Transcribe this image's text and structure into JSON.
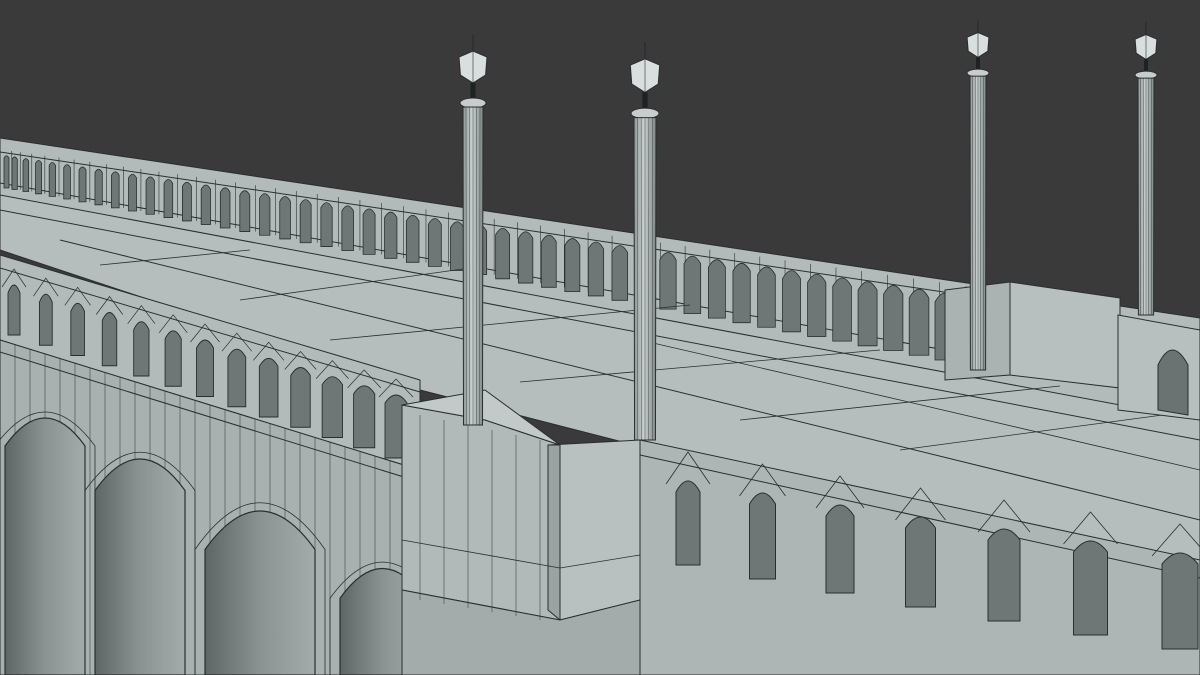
{
  "scene": {
    "subject": "bridge-wireframe-render",
    "lamp_posts": 4,
    "colors": {
      "background": "#3a3a3a",
      "surface_light": "#b9c1c0",
      "surface_mid": "#a9b2b1",
      "surface_dark": "#8f9897",
      "recess": "#6e7776",
      "shadow": "#585f5e",
      "wire": "#2a2e2e"
    }
  }
}
